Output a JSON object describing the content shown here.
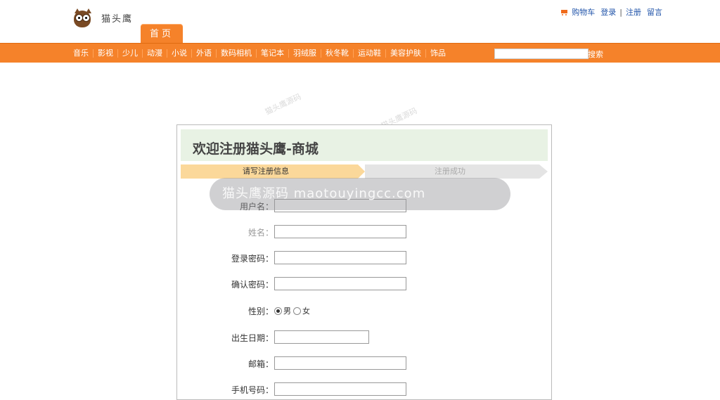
{
  "brand": {
    "name": "猫头鹰"
  },
  "toplinks": {
    "cart": "购物车",
    "login": "登录",
    "separator": "|",
    "register": "注册",
    "message": "留言"
  },
  "home_tab": "首页",
  "nav": {
    "items": [
      "音乐",
      "影视",
      "少儿",
      "动漫",
      "小说",
      "外语",
      "数码相机",
      "笔记本",
      "羽绒服",
      "秋冬靴",
      "运动鞋",
      "美容护肤",
      "饰品"
    ],
    "search_value": "",
    "search_label": "搜索"
  },
  "form": {
    "title": "欢迎注册猫头鹰-商城",
    "steps": [
      "请写注册信息",
      "注册成功"
    ],
    "fields": {
      "username": {
        "label": "用户名：",
        "value": ""
      },
      "realname": {
        "label": "姓名：",
        "value": ""
      },
      "password": {
        "label": "登录密码：",
        "value": ""
      },
      "confirm": {
        "label": "确认密码：",
        "value": ""
      },
      "gender": {
        "label": "性别：",
        "options": [
          "男",
          "女"
        ],
        "selected": "男"
      },
      "birthday": {
        "label": "出生日期：",
        "value": ""
      },
      "email": {
        "label": "邮箱：",
        "value": ""
      },
      "phone": {
        "label": "手机号码：",
        "value": ""
      }
    }
  },
  "watermark": {
    "banner": "猫头鹰源码 maotouyingcc.com",
    "small": "猫头鹰源码"
  },
  "colors": {
    "accent": "#f5822a",
    "link": "#2255aa",
    "title_bg": "#e8f2e4",
    "step_active": "#fbd89a",
    "step_inactive": "#e4e4e4"
  }
}
